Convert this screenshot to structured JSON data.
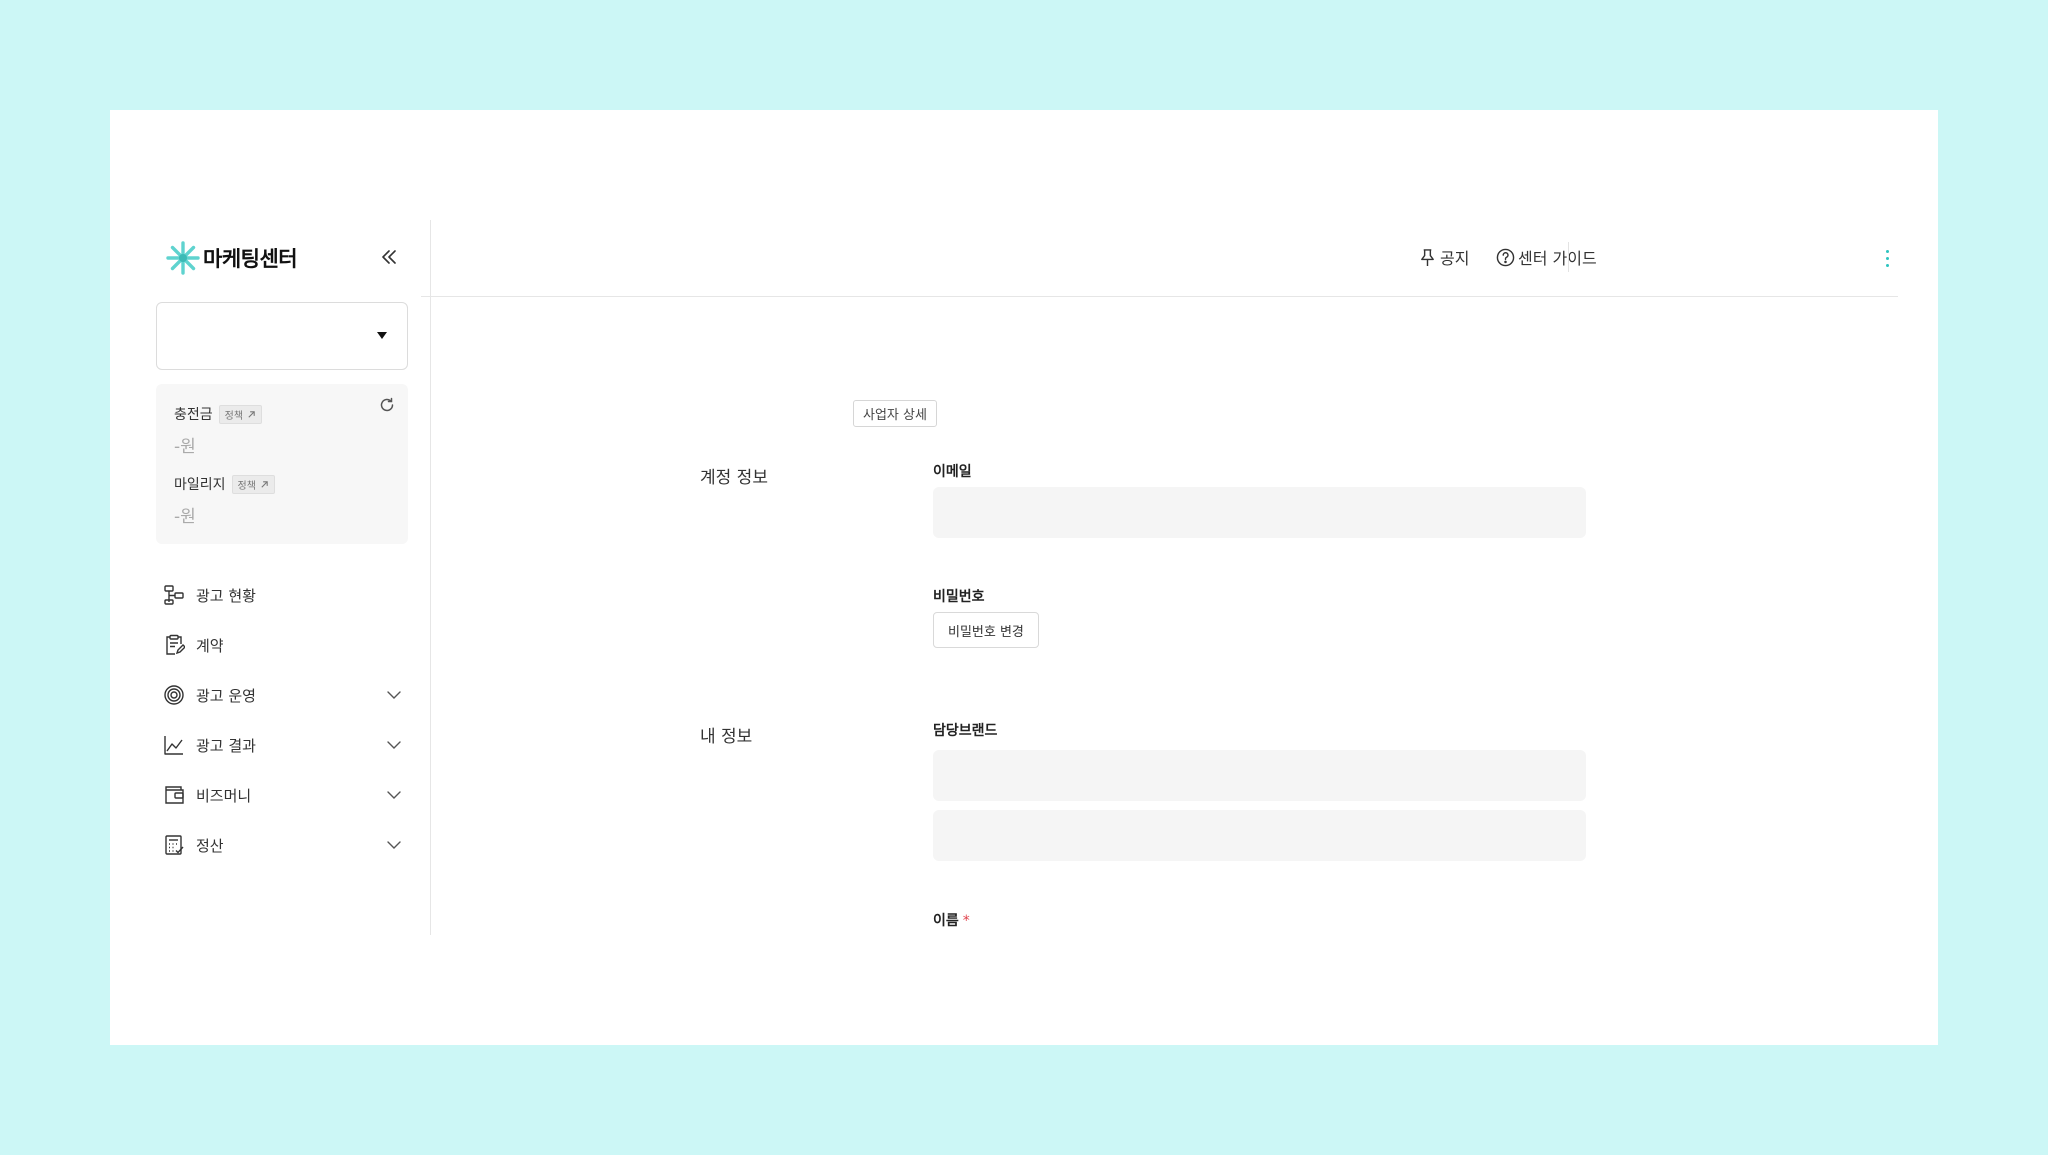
{
  "brand": {
    "name": "마케팅센터",
    "accent": "#5fd3cf"
  },
  "sidebar": {
    "collapse_icon": "chevrons-left-icon",
    "account_select": {
      "value": ""
    },
    "balance": {
      "charge_label": "충전금",
      "charge_policy": "정책",
      "charge_value": "-원",
      "mileage_label": "마일리지",
      "mileage_policy": "정책",
      "mileage_value": "-원",
      "refresh_icon": "refresh-icon"
    },
    "nav": [
      {
        "label": "광고 현황",
        "icon": "flow-chart-icon",
        "expandable": false
      },
      {
        "label": "계약",
        "icon": "clipboard-edit-icon",
        "expandable": false
      },
      {
        "label": "광고 운영",
        "icon": "target-icon",
        "expandable": true
      },
      {
        "label": "광고 결과",
        "icon": "line-chart-icon",
        "expandable": true
      },
      {
        "label": "비즈머니",
        "icon": "wallet-icon",
        "expandable": true
      },
      {
        "label": "정산",
        "icon": "calculator-icon",
        "expandable": true
      }
    ]
  },
  "header": {
    "notice_label": "공지",
    "guide_label": "센터 가이드",
    "more_icon": "more-vertical-icon"
  },
  "main": {
    "biz_detail_button": "사업자 상세",
    "account_section": {
      "title": "계정 정보",
      "email_label": "이메일",
      "email_value": "",
      "password_label": "비밀번호",
      "password_change_button": "비밀번호 변경"
    },
    "my_info_section": {
      "title": "내 정보",
      "brand_label": "담당브랜드",
      "brand_value_1": "",
      "brand_value_2": "",
      "name_label": "이름",
      "required_mark": "*"
    }
  }
}
